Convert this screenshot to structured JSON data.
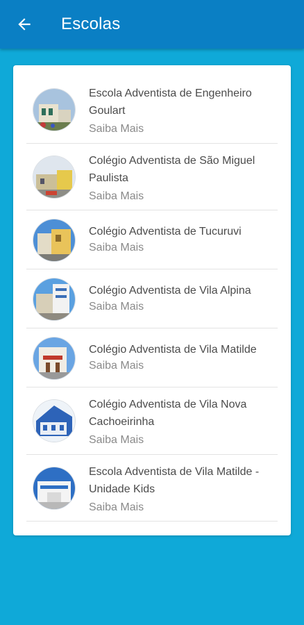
{
  "header": {
    "title": "Escolas",
    "back_icon": "arrow-left-icon"
  },
  "colors": {
    "appbar": "#0a7fc4",
    "background": "#0fa9d8",
    "card": "#ffffff"
  },
  "schools": [
    {
      "name": "Escola Adventista de Engenheiro Goulart",
      "link": "Saiba Mais"
    },
    {
      "name": "Colégio Adventista de São Miguel Paulista",
      "link": "Saiba Mais"
    },
    {
      "name": "Colégio Adventista de Tucuruvi",
      "link": "Saiba Mais"
    },
    {
      "name": "Colégio Adventista de Vila Alpina",
      "link": "Saiba Mais"
    },
    {
      "name": "Colégio Adventista de Vila Matilde",
      "link": "Saiba Mais"
    },
    {
      "name": "Colégio Adventista de Vila Nova Cachoeirinha",
      "link": "Saiba Mais"
    },
    {
      "name": "Escola Adventista de Vila Matilde - Unidade Kids",
      "link": "Saiba Mais"
    }
  ]
}
